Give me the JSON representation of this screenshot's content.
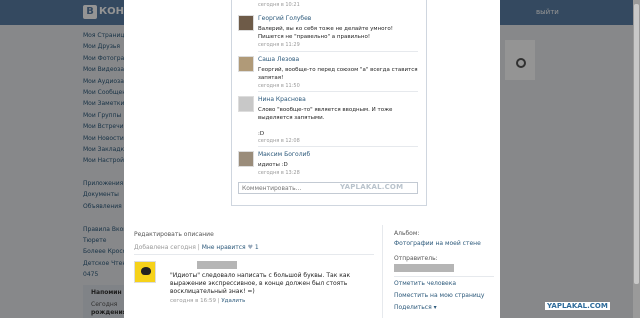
{
  "background": {
    "logo_letter": "B",
    "logo_text": "КОН",
    "exit_label": "выйти",
    "sidebar_items": [
      "Моя Страница",
      "Мои Друзья",
      "Мои Фотографии",
      "Мои Видеозаписи",
      "Мои Аудиозаписи",
      "Мои Сообщения",
      "Мои Заметки",
      "Мои Группы",
      "Мои Встречи",
      "Мои Новости",
      "Мои Закладки",
      "Мои Настройки",
      "",
      "Приложения",
      "Документы",
      "Объявления",
      "",
      "Правила Вконтакте",
      "Тюрете",
      "Болеее Кросс",
      "Детское Чтение",
      "0475"
    ],
    "bottom_left": {
      "title": "Напомин",
      "line1": "Сегодня",
      "line2": "рождения"
    }
  },
  "comments": [
    {
      "name": "Георгий Голубев",
      "text": "Валерий, вы ко себя тоже не делайте умного! Пишется не \"правельно\" а правильно!",
      "time": "сегодня в 11:29"
    },
    {
      "name": "Саша Лезова",
      "text": "Георгий, вообще-то перед союзом \"а\" всегда ставится запятая!",
      "time": "сегодня в 11:50"
    },
    {
      "name": "Нина Краснова",
      "text": "Слово \"вообще-то\" является вводным. И тоже выделяется запятыми.\n\n:D",
      "time": "сегодня в 12:08"
    },
    {
      "name": "Максим Боголиб",
      "text": "идиоты :D",
      "time": "сегодня в 13:28"
    }
  ],
  "top_timestamp": "сегодня в 10:21",
  "comment_input": {
    "placeholder": "Комментировать..."
  },
  "watermark": "YAPLAKAL.COM",
  "photo_meta": {
    "edit_description": "Редактировать описание",
    "added": "Добавлена сегодня",
    "separator": "|",
    "like_label": "Мне нравится",
    "like_count": "1"
  },
  "main_comment": {
    "text": "\"Идиоты\" следовало написать с большой буквы. Так как выражение экспрессивное, в конце должен был стоять восклицательный знак! =)",
    "time": "сегодня в 16:59",
    "delete_label": "Удалить"
  },
  "right_column": {
    "album_label": "Альбом:",
    "album_link": "Фотографии на моей стене",
    "sender_label": "Отправитель:",
    "tag_person": "Отметить человека",
    "post_to_page": "Поместить на мою страницу",
    "share": "Поделиться ▾"
  },
  "footer_watermark": "YAPLAKAL.COM"
}
